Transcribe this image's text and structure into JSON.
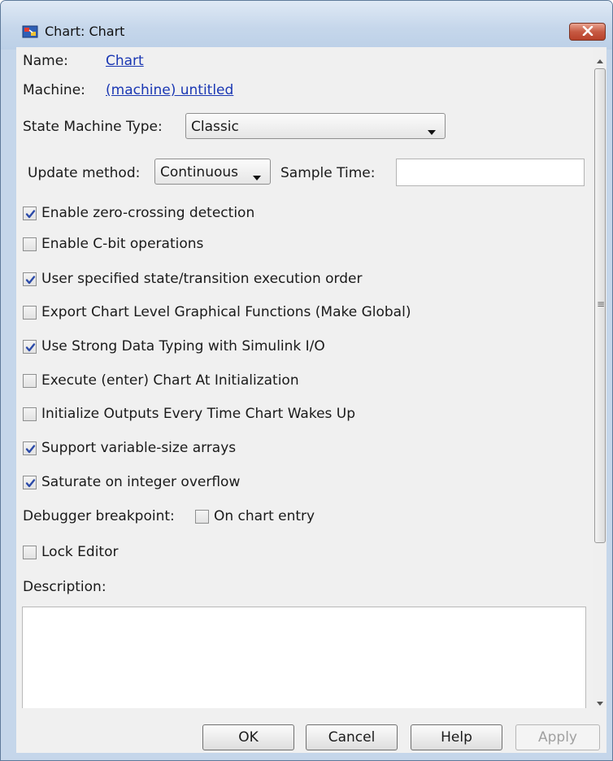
{
  "window": {
    "title": "Chart: Chart"
  },
  "fields": {
    "name_label": "Name:",
    "name_value": "Chart",
    "machine_label": "Machine:",
    "machine_value": "(machine) untitled",
    "state_machine_label": "State Machine Type:",
    "state_machine_value": "Classic",
    "update_method_label": "Update method:",
    "update_method_value": "Continuous",
    "sample_time_label": "Sample Time:",
    "sample_time_value": ""
  },
  "checkboxes": [
    {
      "label": "Enable zero-crossing detection",
      "checked": true
    },
    {
      "label": "Enable C-bit operations",
      "checked": false
    },
    {
      "label": "User specified state/transition execution order",
      "checked": true
    },
    {
      "label": "Export Chart Level Graphical Functions (Make Global)",
      "checked": false
    },
    {
      "label": "Use Strong Data Typing with Simulink I/O",
      "checked": true
    },
    {
      "label": "Execute (enter) Chart At Initialization",
      "checked": false
    },
    {
      "label": "Initialize Outputs Every Time Chart Wakes Up",
      "checked": false
    },
    {
      "label": "Support variable-size arrays",
      "checked": true
    },
    {
      "label": "Saturate on integer overflow",
      "checked": true
    }
  ],
  "debugger": {
    "label": "Debugger breakpoint:",
    "option_label": "On chart entry",
    "checked": false
  },
  "lock_editor": {
    "label": "Lock Editor",
    "checked": false
  },
  "description": {
    "label": "Description:",
    "value": ""
  },
  "buttons": {
    "ok": "OK",
    "cancel": "Cancel",
    "help": "Help",
    "apply": "Apply"
  },
  "scrollbar": {
    "grip": "≡"
  },
  "icons": {
    "close": "close-icon",
    "app": "stateflow-chart-icon",
    "dropdown": "dropdown-arrow-icon",
    "check": "checkmark-icon"
  }
}
